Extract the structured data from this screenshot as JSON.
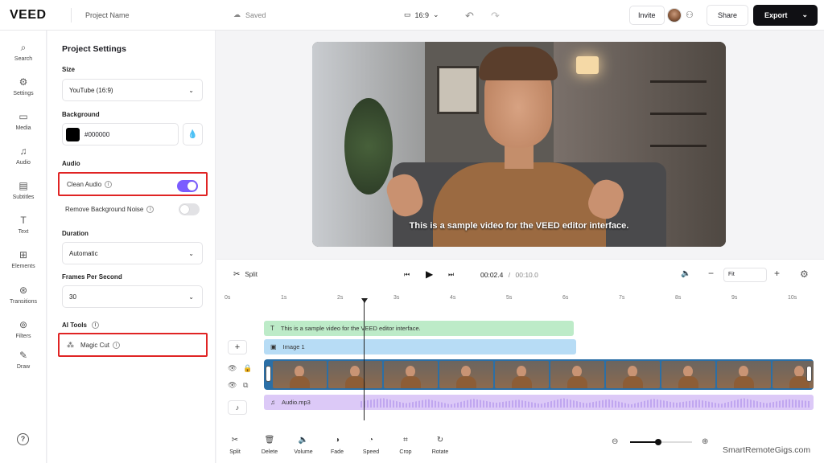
{
  "header": {
    "logo": "VEED",
    "project_name": "Project Name",
    "saved": "Saved",
    "aspect": "16:9",
    "invite": "Invite",
    "share": "Share",
    "export": "Export"
  },
  "rail": [
    {
      "label": "Search",
      "icon": "search-icon"
    },
    {
      "label": "Settings",
      "icon": "gear-icon"
    },
    {
      "label": "Media",
      "icon": "folder-icon"
    },
    {
      "label": "Audio",
      "icon": "music-icon"
    },
    {
      "label": "Subtitles",
      "icon": "subtitles-icon"
    },
    {
      "label": "Text",
      "icon": "text-icon"
    },
    {
      "label": "Elements",
      "icon": "elements-icon"
    },
    {
      "label": "Transitions",
      "icon": "transitions-icon"
    },
    {
      "label": "Filters",
      "icon": "filters-icon"
    },
    {
      "label": "Draw",
      "icon": "pen-icon"
    }
  ],
  "panel": {
    "title": "Project Settings",
    "size_label": "Size",
    "size_value": "YouTube (16:9)",
    "background_label": "Background",
    "background_value": "#000000",
    "audio_label": "Audio",
    "clean_audio": "Clean Audio",
    "clean_audio_on": true,
    "remove_noise": "Remove Background Noise",
    "remove_noise_on": false,
    "duration_label": "Duration",
    "duration_value": "Automatic",
    "fps_label": "Frames Per Second",
    "fps_value": "30",
    "ai_tools_label": "AI Tools",
    "magic_cut": "Magic Cut"
  },
  "preview": {
    "subtitle": "This is a sample video for the VEED editor interface."
  },
  "timeline": {
    "split": "Split",
    "current_time": "00:02.4",
    "separator": "/",
    "total_time": "00:10.0",
    "zoom_mode": "Fit",
    "ruler": [
      "0s",
      "1s",
      "2s",
      "3s",
      "4s",
      "5s",
      "6s",
      "7s",
      "8s",
      "9s",
      "10s"
    ],
    "text_track": "This is a sample video for the VEED editor interface.",
    "image_track": "Image 1",
    "audio_track": "Audio.mp3",
    "zoom_level": 0.45
  },
  "tools": [
    "Split",
    "Delete",
    "Volume",
    "Fade",
    "Speed",
    "Crop",
    "Rotate"
  ],
  "watermark": "SmartRemoteGigs.com",
  "colors": {
    "accent": "#7a5cff",
    "highlight": "#e02424",
    "export_bg": "#101014"
  }
}
